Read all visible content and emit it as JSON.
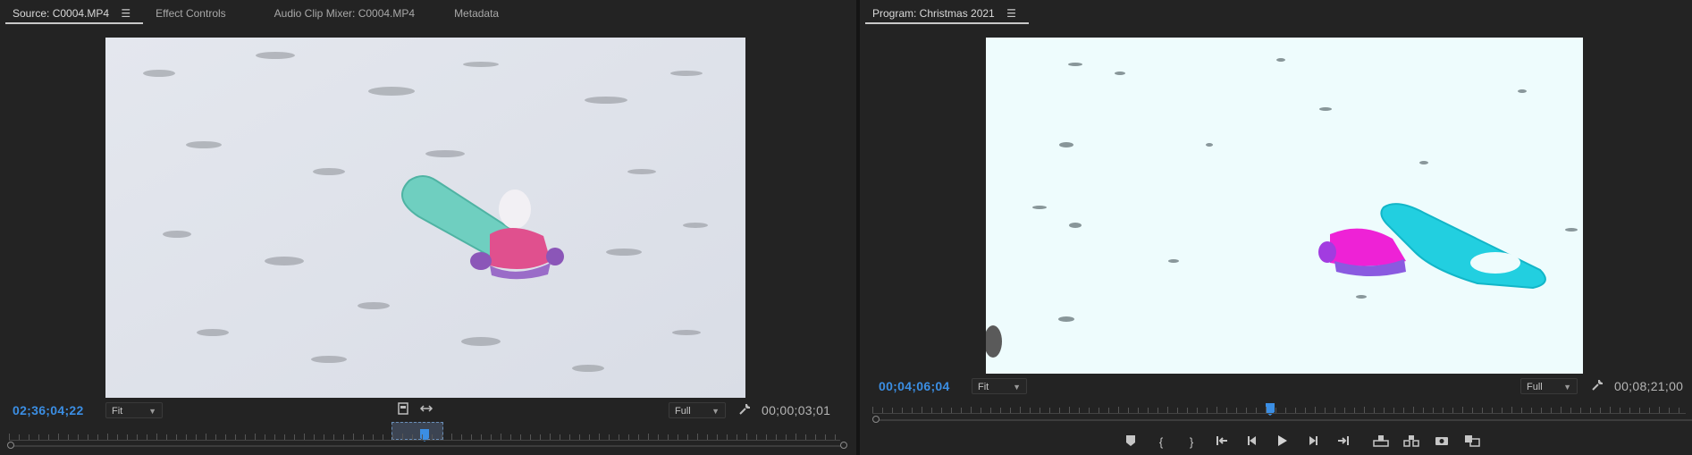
{
  "source": {
    "tabs": [
      {
        "label": "Source: C0004.MP4",
        "active": true
      },
      {
        "label": "Effect Controls"
      },
      {
        "label": "Audio Clip Mixer: C0004.MP4"
      },
      {
        "label": "Metadata"
      }
    ],
    "menu_icon": "☰",
    "timecode_current": "02;36;04;22",
    "timecode_duration": "00;00;03;01",
    "zoom": "Fit",
    "resolution": "Full",
    "playhead_position": 0.52
  },
  "program": {
    "title": "Program: Christmas 2021",
    "menu_icon": "☰",
    "timecode_current": "00;04;06;04",
    "timecode_duration": "00;08;21;00",
    "zoom": "Fit",
    "resolution": "Full",
    "playhead_position": 0.49,
    "transport_icons": [
      "add-marker",
      "mark-in",
      "mark-out",
      "go-to-in",
      "step-back",
      "play",
      "step-forward",
      "go-to-out",
      "lift",
      "extract",
      "export-frame",
      "compare"
    ]
  },
  "colors": {
    "accent_blue": "#3b8ee3",
    "panel_bg": "#232323"
  }
}
